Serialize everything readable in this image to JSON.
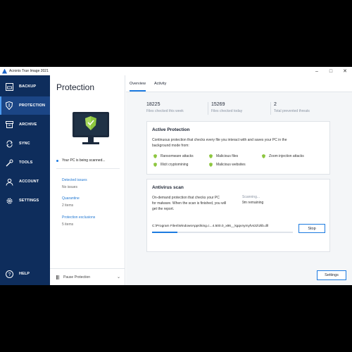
{
  "window": {
    "title": "Acronis True Image 2021",
    "controls": [
      "minimize",
      "maximize",
      "close"
    ]
  },
  "sidebar": {
    "items": [
      {
        "label": "BACKUP",
        "icon": "backup-icon"
      },
      {
        "label": "PROTECTION",
        "icon": "shield-icon",
        "active": true
      },
      {
        "label": "ARCHIVE",
        "icon": "archive-icon"
      },
      {
        "label": "SYNC",
        "icon": "sync-icon"
      },
      {
        "label": "TOOLS",
        "icon": "tools-icon"
      },
      {
        "label": "ACCOUNT",
        "icon": "account-icon"
      },
      {
        "label": "SETTINGS",
        "icon": "gear-icon"
      }
    ],
    "help": {
      "label": "HELP",
      "icon": "help-icon"
    }
  },
  "panel": {
    "title": "Protection",
    "status": "Your PC is being scanned...",
    "detected": {
      "label": "Detected issues",
      "value": "No issues"
    },
    "quarantine": {
      "label": "Quarantine",
      "value": "2 items"
    },
    "exclusions": {
      "label": "Protection exclusions",
      "value": "5 items"
    },
    "pause_label": "Pause Protection"
  },
  "tabs": [
    "Overview",
    "Activity"
  ],
  "stats": [
    {
      "number": "18225",
      "desc": "Files checked this week"
    },
    {
      "number": "15269",
      "desc": "Files checked today"
    },
    {
      "number": "2",
      "desc": "Total prevented threats"
    }
  ],
  "active_protection": {
    "title": "Active Protection",
    "description_line1": "Continuous protection that checks every file you interact with and saves your PC in the",
    "description_line2": "background mode from:",
    "features": [
      "Ransomware attacks",
      "Malicious files",
      "Zoom injection attacks",
      "Illicit cryptomining",
      "Malicious websites"
    ],
    "accent_color": "#8dc63f"
  },
  "antivirus_scan": {
    "title": "Antivirus scan",
    "description_line1": "On-demand protection that checks your PC",
    "description_line2": "for malware. When the scan is finished, you will",
    "description_line3": "get the report.",
    "state": "Scanning...",
    "remaining": "9m remaining",
    "current_path": "C:\\Program Files\\WindowsApps\\king.c...4.500.0_x86__kgqvnymyfvs32\\zlib.dll",
    "progress": 0.18,
    "stop_label": "Stop"
  },
  "footer": {
    "settings_label": "Settings"
  },
  "colors": {
    "sidebar": "#0e2d5c",
    "sidebar_active": "#1b4585",
    "accent": "#1d7be0"
  }
}
